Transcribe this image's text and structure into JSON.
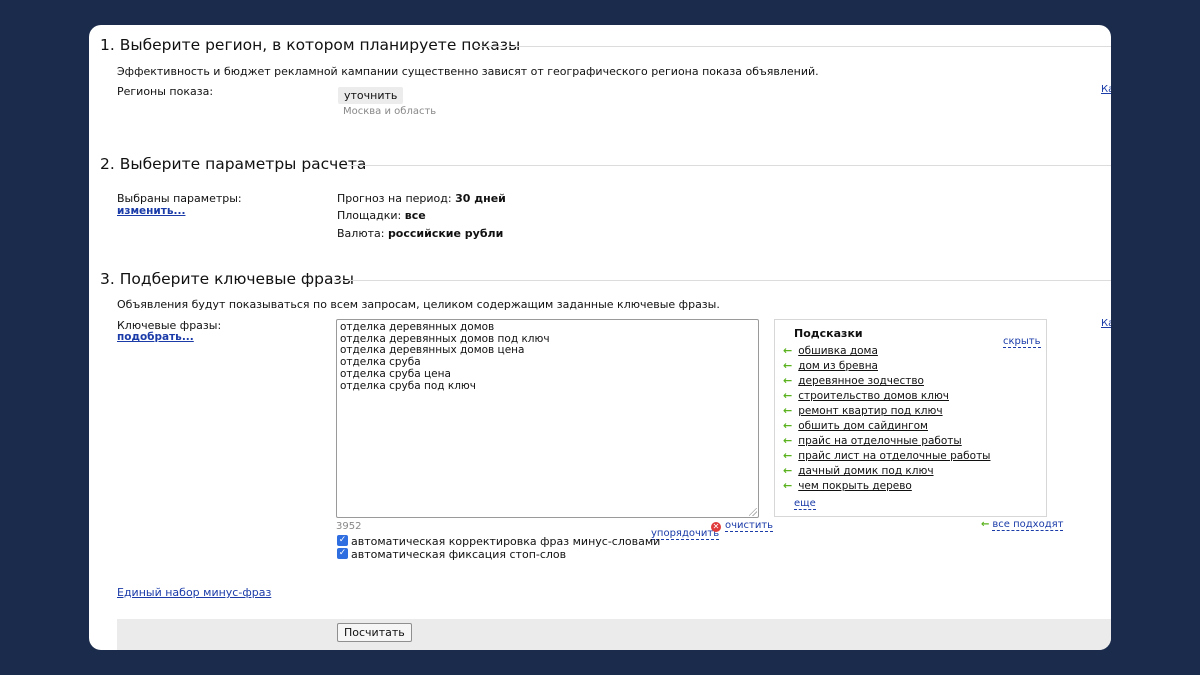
{
  "section1": {
    "title": "1. Выберите регион, в котором планируете показы",
    "description": "Эффективность и бюджет рекламной кампании существенно зависят от географического региона показа объявлений.",
    "regions_label": "Регионы показа:",
    "refine_button": "уточнить",
    "selected_region": "Москва и область",
    "side_link": "Ка"
  },
  "section2": {
    "title": "2. Выберите параметры расчета",
    "selected_label": "Выбраны параметры:",
    "change_link": "изменить...",
    "params": [
      {
        "label": "Прогноз на период:",
        "value": "30 дней"
      },
      {
        "label": "Площадки:",
        "value": "все"
      },
      {
        "label": "Валюта:",
        "value": "российские рубли"
      }
    ]
  },
  "section3": {
    "title": "3. Подберите ключевые фразы",
    "description": "Объявления будут показываться по всем запросам, целиком содержащим заданные ключевые фразы.",
    "keywords_label": "Ключевые фразы:",
    "pick_link": "подобрать...",
    "keywords": [
      "отделка деревянных домов",
      "отделка деревянных домов под ключ",
      "отделка деревянных домов цена",
      "отделка сруба",
      "отделка сруба цена",
      "отделка сруба под ключ"
    ],
    "char_count": "3952",
    "sort_link": "упорядочить",
    "clear_link": "очистить",
    "checkboxes": [
      {
        "label": "автоматическая корректировка фраз минус-словами",
        "checked": true
      },
      {
        "label": "автоматическая фиксация стоп-слов",
        "checked": true
      }
    ],
    "side_link": "Ка"
  },
  "hints": {
    "title": "Подсказки",
    "hide_link": "скрыть",
    "items": [
      "обшивка дома",
      "дом из бревна",
      "деревянное зодчество",
      "строительство домов ключ",
      "ремонт квартир под ключ",
      "обшить дом сайдингом",
      "прайс на отделочные работы",
      "прайс лист на отделочные работы",
      "дачный домик под ключ",
      "чем покрыть дерево"
    ],
    "more_link": "еще",
    "all_fit_link": "все подходят"
  },
  "minus_phrases_link": "Единый набор минус-фраз",
  "submit_button": "Посчитать",
  "colors": {
    "background": "#1b2b4b",
    "link": "#1a3ba8",
    "hint_arrow": "#5ab21e",
    "checkbox": "#2f6ee0",
    "clear_icon": "#e03a3a"
  }
}
